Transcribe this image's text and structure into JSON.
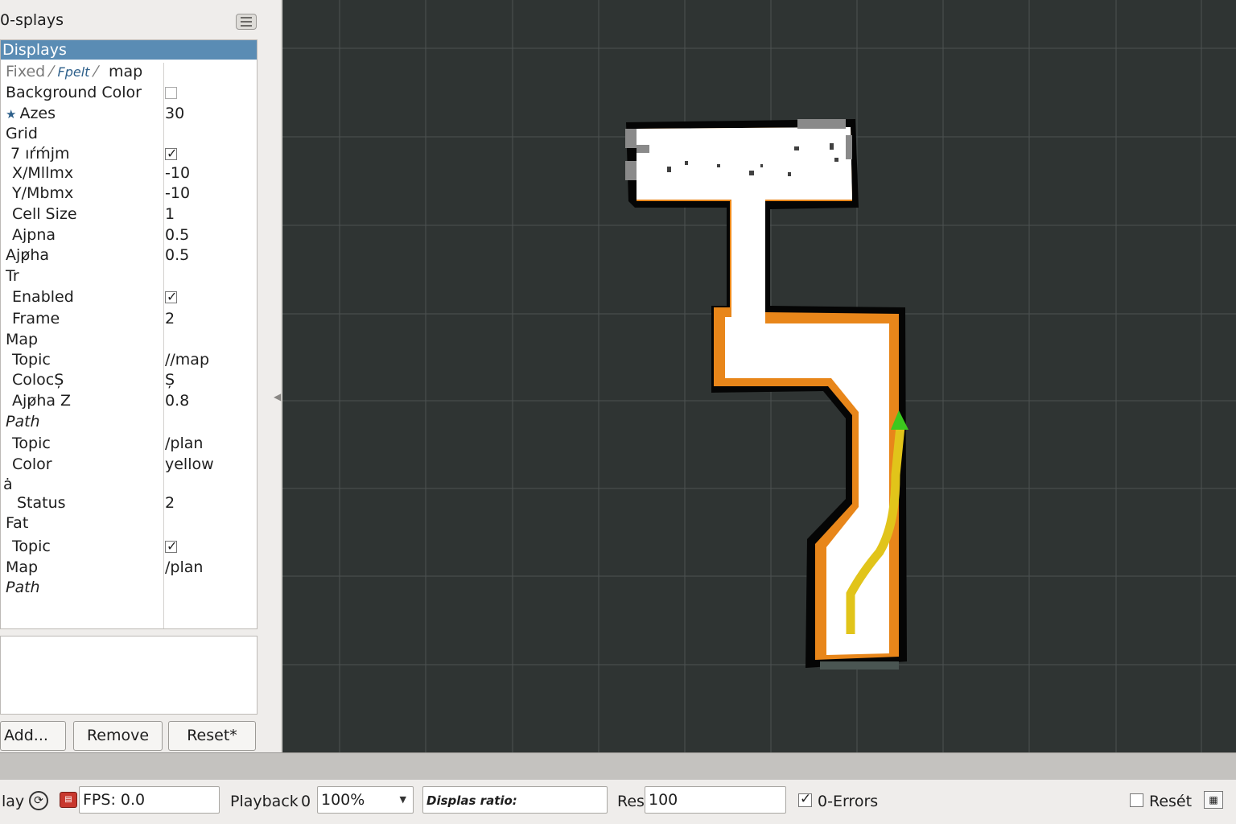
{
  "panel": {
    "title": "0-splays",
    "header": "Displays",
    "rows": [
      {
        "name": "Fixed",
        "value": "map"
      },
      {
        "name": "Background Color",
        "value": ""
      },
      {
        "name": "Azes",
        "value": "30"
      },
      {
        "name": "Grid",
        "value": ""
      },
      {
        "name": "7 ıŕḿjm",
        "value": ""
      },
      {
        "name": "X/Mllmx",
        "value": "-10"
      },
      {
        "name": "Y/Mbmx",
        "value": "-10"
      },
      {
        "name": "Cell Size",
        "value": "1"
      },
      {
        "name": "Ajpna",
        "value": "0.5"
      },
      {
        "name": "Ajp̷ha",
        "value": "0.5"
      },
      {
        "name": "Tr",
        "value": ""
      },
      {
        "name": "Enabled",
        "value": ""
      },
      {
        "name": "Frame",
        "value": "2"
      },
      {
        "name": "Map",
        "value": ""
      },
      {
        "name": "Topic",
        "value": "//map"
      },
      {
        "name": "ColocȘ",
        "value": "Ș"
      },
      {
        "name": "Ajp̷ha Z",
        "value": "0.8"
      },
      {
        "name": "Path",
        "value": ""
      },
      {
        "name": "Topic",
        "value": "/plan"
      },
      {
        "name": "Color",
        "value": "yellow"
      },
      {
        "name": "ȧ",
        "value": ""
      },
      {
        "name": "Status",
        "value": "2"
      },
      {
        "name": "Fat",
        "value": ""
      },
      {
        "name": "Topic",
        "value": ""
      },
      {
        "name": "Map",
        "value": "/plan"
      },
      {
        "name": "Path",
        "value": ""
      }
    ],
    "fixed_suffix": "Fpelt",
    "buttons": {
      "add": "Add...",
      "remove": "Remove",
      "reset": "Reset*"
    }
  },
  "status": {
    "play_label": "lay",
    "fps": "FPS: 0.0",
    "playback_label": "Playback",
    "playback_value": "0",
    "zoom": "100%",
    "ratio_label": "Displas ratio:",
    "res_label": "Res",
    "res_value": "100",
    "errors_label": "0-Errors",
    "reset_label": "Resét"
  },
  "colors": {
    "selection": "#5a8cb4",
    "viewport_bg": "#2f3433",
    "costmap": "#e8861a",
    "path": "#e1c41a",
    "goal_arrow": "#3cc81e"
  }
}
